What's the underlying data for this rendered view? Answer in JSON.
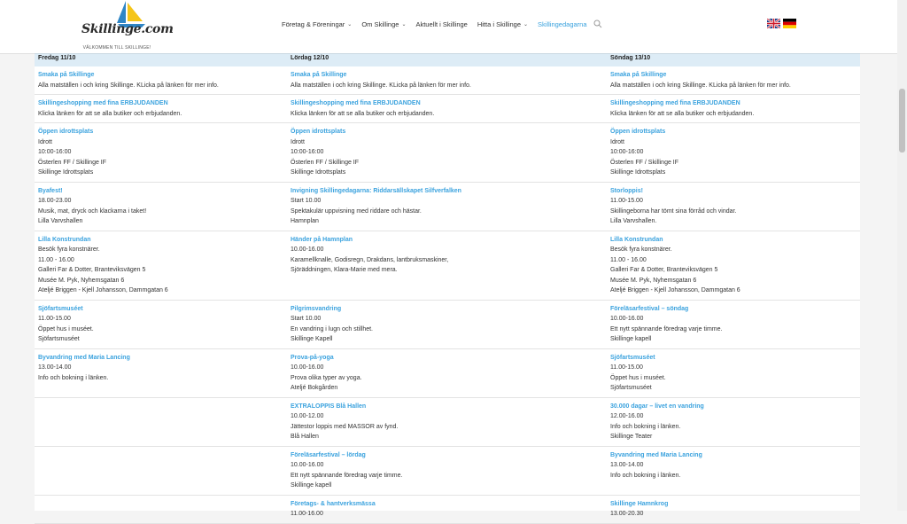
{
  "logo": {
    "text": "Skillinge.com",
    "tagline": "VÄLKOMMEN TILL SKILLINGE!"
  },
  "nav": [
    {
      "label": "Företag & Föreningar",
      "dropdown": true,
      "active": false
    },
    {
      "label": "Om Skillinge",
      "dropdown": true,
      "active": false
    },
    {
      "label": "Aktuellt i Skillinge",
      "dropdown": false,
      "active": false
    },
    {
      "label": "Hitta i Skillinge",
      "dropdown": true,
      "active": false
    },
    {
      "label": "Skillingedagarna",
      "dropdown": false,
      "active": true
    }
  ],
  "flags": [
    "uk-flag-icon",
    "german-flag-icon"
  ],
  "colors": {
    "link": "#3aa2de",
    "header_row": "#ddecf6",
    "background": "#f4f4f4"
  },
  "days": [
    "Fredag 11/10",
    "Lördag 12/10",
    "Söndag 13/10"
  ],
  "rows": [
    {
      "cells": [
        {
          "title": "Smaka på Skillinge",
          "lines": [
            "Alla matställen i och kring Skillinge. KLicka på länken för mer info."
          ]
        },
        {
          "title": "Smaka på Skillinge",
          "lines": [
            "Alla matställen i och kring Skillinge. KLicka på länken för mer info."
          ]
        },
        {
          "title": "Smaka på Skillinge",
          "lines": [
            "Alla matställen i och kring Skillinge. KLicka på länken för mer info."
          ]
        }
      ]
    },
    {
      "cells": [
        {
          "title": "Skillingeshopping med fina ERBJUDANDEN",
          "lines": [
            "Klicka länken för att se alla butiker och erbjudanden."
          ]
        },
        {
          "title": "Skillingeshopping med fina ERBJUDANDEN",
          "lines": [
            "Klicka länken för att se alla butiker och erbjudanden."
          ]
        },
        {
          "title": "Skillingeshopping med fina ERBJUDANDEN",
          "lines": [
            "Klicka länken för att se alla butiker och erbjudanden."
          ]
        }
      ]
    },
    {
      "cells": [
        {
          "title": "Öppen idrottsplats",
          "lines": [
            "Idrott",
            "10:00-16:00",
            "Österlen FF / Skillinge IF",
            "Skillinge Idrottsplats"
          ]
        },
        {
          "title": "Öppen idrottsplats",
          "lines": [
            "Idrott",
            "10:00-16:00",
            "Österlen FF / Skillinge IF",
            "Skillinge Idrottsplats"
          ]
        },
        {
          "title": "Öppen idrottsplats",
          "lines": [
            "Idrott",
            "10:00-16:00",
            "Österlen FF / Skillinge IF",
            "Skillinge Idrottsplats"
          ]
        }
      ]
    },
    {
      "cells": [
        {
          "title": "Byafest!",
          "lines": [
            "18.00-23.00",
            "Musik, mat, dryck och klackarna i taket!",
            "Lilla Varvshallen"
          ]
        },
        {
          "title": "Invigning Skillingedagarna: Riddarsällskapet Silfverfalken",
          "lines": [
            "Start 10.00",
            "Spektakulär uppvisning med riddare och hästar.",
            "Hamnplan"
          ]
        },
        {
          "title": "Storloppis!",
          "lines": [
            "11.00-15.00",
            "Skillingeborna har tömt sina förråd och vindar.",
            "Lilla Varvshallen."
          ]
        }
      ]
    },
    {
      "cells": [
        {
          "title": "Lilla Konstrundan",
          "lines": [
            "Besök fyra konstnärer.",
            "11.00 - 16.00",
            "Galleri Far & Dotter, Branteviksvägen 5",
            "Musée M. Pyk, Nyhemsgatan 6",
            "Ateljé Briggen - Kjell Johansson, Dammgatan 6"
          ]
        },
        {
          "title": "Händer på Hamnplan",
          "lines": [
            "10.00-16.00",
            "Karamellknalle, Godisregn, Drakdans, lantbruksmaskiner,",
            "Sjöräddningen, Klara-Marie med mera."
          ]
        },
        {
          "title": "Lilla Konstrundan",
          "lines": [
            "Besök fyra konstnärer.",
            "11.00 - 16.00",
            "Galleri Far & Dotter, Branteviksvägen 5",
            "Musée M. Pyk, Nyhemsgatan 6",
            "Ateljé Briggen - Kjell Johansson, Dammgatan 6"
          ]
        }
      ]
    },
    {
      "cells": [
        {
          "title": "Sjöfartsmuséet",
          "lines": [
            "11.00-15.00",
            "Öppet hus i muséet.",
            "Sjöfartsmuséet"
          ]
        },
        {
          "title": "Pilgrimsvandring",
          "lines": [
            "Start 10.00",
            "En vandring i lugn och stillhet.",
            "Skillinge Kapell"
          ]
        },
        {
          "title": "Föreläsarfestival – söndag",
          "lines": [
            "10.00-16.00",
            "Ett nytt spännande föredrag varje timme.",
            "Skillinge kapell"
          ]
        }
      ]
    },
    {
      "cells": [
        {
          "title": "Byvandring med Maria Lancing",
          "lines": [
            "13.00-14.00",
            "Info och bokning i länken."
          ]
        },
        {
          "title": "Prova-på-yoga",
          "lines": [
            "10.00-16.00",
            "Prova olika typer av yoga.",
            "Ateljé Bokgården"
          ]
        },
        {
          "title": "Sjöfartsmuséet",
          "lines": [
            "11.00-15.00",
            "Öppet hus i muséet.",
            "Sjöfartsmuséet"
          ]
        }
      ]
    },
    {
      "cells": [
        null,
        {
          "title": "EXTRALOPPIS Blå Hallen",
          "lines": [
            "10.00-12.00",
            "Jättestor loppis med MASSOR av fynd.",
            "Blå Hallen"
          ]
        },
        {
          "title": "30.000 dagar – livet en vandring",
          "lines": [
            "12.00-16.00",
            "Info och bokning i länken.",
            "Skillinge Teater"
          ]
        }
      ]
    },
    {
      "cells": [
        null,
        {
          "title": "Föreläsarfestival – lördag",
          "lines": [
            "10.00-16.00",
            "Ett nytt spännande föredrag varje timme.",
            "Skillinge kapell"
          ]
        },
        {
          "title": "Byvandring med Maria Lancing",
          "lines": [
            "13.00-14.00",
            "Info och bokning i länken."
          ]
        }
      ]
    },
    {
      "cells": [
        null,
        {
          "title": "Företags- & hantverksmässa",
          "lines": [
            "11.00-16.00"
          ]
        },
        {
          "title": "Skillinge Hamnkrog",
          "lines": [
            "13.00-20.30"
          ]
        }
      ]
    }
  ]
}
